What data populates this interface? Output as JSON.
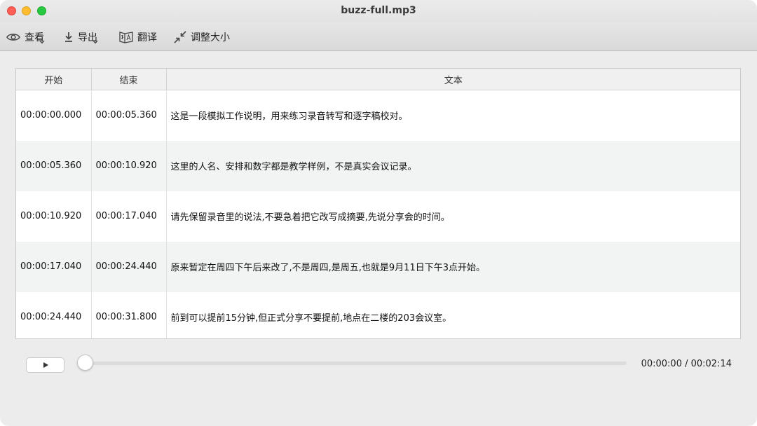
{
  "window": {
    "title": "buzz-full.mp3"
  },
  "toolbar": {
    "view_label": "查看",
    "export_label": "导出",
    "translate_label": "翻译",
    "resize_label": "调整大小"
  },
  "table": {
    "headers": [
      "开始",
      "结束",
      "文本"
    ],
    "rows": [
      {
        "start": "00:00:00.000",
        "end": "00:00:05.360",
        "text": "这是一段模拟工作说明，用来练习录音转写和逐字稿校对。"
      },
      {
        "start": "00:00:05.360",
        "end": "00:00:10.920",
        "text": "这里的人名、安排和数字都是教学样例，不是真实会议记录。"
      },
      {
        "start": "00:00:10.920",
        "end": "00:00:17.040",
        "text": "请先保留录音里的说法,不要急着把它改写成摘要,先说分享会的时间。"
      },
      {
        "start": "00:00:17.040",
        "end": "00:00:24.440",
        "text": "原来暂定在周四下午后来改了,不是周四,是周五,也就是9月11日下午3点开始。"
      },
      {
        "start": "00:00:24.440",
        "end": "00:00:31.800",
        "text": "前到可以提前15分钟,但正式分享不要提前,地点在二楼的203会议室。"
      }
    ]
  },
  "player": {
    "current_time": "00:00:00",
    "total_time": "00:02:14",
    "time_display": "00:00:00 / 00:02:14",
    "progress": 0
  },
  "icons": {
    "view": "eye-icon",
    "export": "download-icon",
    "translate": "translate-icon",
    "resize": "resize-icon",
    "play": "play-icon"
  },
  "colors": {
    "close": "#ff5f57",
    "minimize": "#febc2e",
    "maximize": "#28c840",
    "row_alt": "#f2f3f3"
  }
}
